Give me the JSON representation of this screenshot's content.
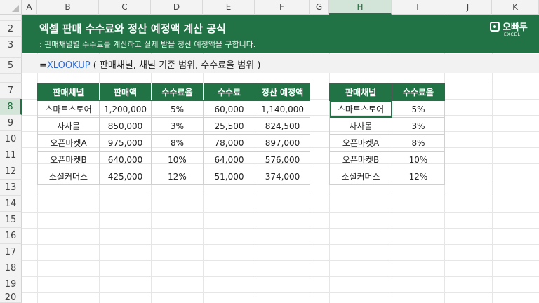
{
  "sheet": {
    "columns": [
      "A",
      "B",
      "C",
      "D",
      "E",
      "F",
      "G",
      "H",
      "I",
      "J",
      "K"
    ],
    "rows": [
      "2",
      "3",
      "5",
      "7",
      "8",
      "9",
      "10",
      "11",
      "12",
      "13",
      "14",
      "15",
      "16",
      "17",
      "18",
      "19",
      "20"
    ],
    "selected_column": "H",
    "selected_row": "8"
  },
  "banner": {
    "title": "엑셀 판매 수수료와 정산 예정액 계산 공식",
    "subtitle": ": 판매채널별 수수료를 계산하고 실제 받을 정산 예정액을 구합니다.",
    "logo_name": "오빠두",
    "logo_sub": "EXCEL"
  },
  "formula": {
    "prefix": "=",
    "function": "XLOOKUP",
    "args": " ( 판매채널, 채널 기준 범위, 수수료율 범위 )"
  },
  "main_table": {
    "headers": [
      "판매채널",
      "판매액",
      "수수료율",
      "수수료",
      "정산 예정액"
    ],
    "rows": [
      [
        "스마트스토어",
        "1,200,000",
        "5%",
        "60,000",
        "1,140,000"
      ],
      [
        "자사몰",
        "850,000",
        "3%",
        "25,500",
        "824,500"
      ],
      [
        "오픈마켓A",
        "975,000",
        "8%",
        "78,000",
        "897,000"
      ],
      [
        "오픈마켓B",
        "640,000",
        "10%",
        "64,000",
        "576,000"
      ],
      [
        "소셜커머스",
        "425,000",
        "12%",
        "51,000",
        "374,000"
      ]
    ]
  },
  "rate_table": {
    "headers": [
      "판매채널",
      "수수료율"
    ],
    "rows": [
      [
        "스마트스토어",
        "5%"
      ],
      [
        "자사몰",
        "3%"
      ],
      [
        "오픈마켓A",
        "8%"
      ],
      [
        "오픈마켓B",
        "10%"
      ],
      [
        "소셜커머스",
        "12%"
      ]
    ]
  },
  "colors": {
    "accent": "#217346",
    "formula_function": "#2b6cd6"
  }
}
